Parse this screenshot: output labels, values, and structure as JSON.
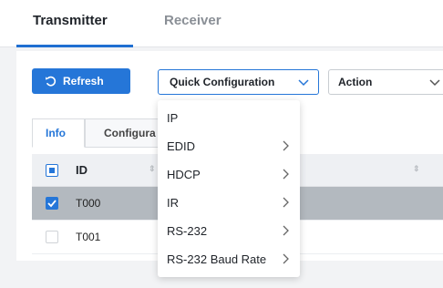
{
  "tabs": {
    "transmitter": "Transmitter",
    "receiver": "Receiver"
  },
  "toolbar": {
    "refresh_label": "Refresh",
    "quick_config_label": "Quick Configuration",
    "action_label": "Action"
  },
  "subtabs": {
    "info": "Info",
    "configuration": "Configura"
  },
  "table": {
    "header_id": "ID",
    "rows": [
      {
        "id": "T000",
        "selected": true
      },
      {
        "id": "T001",
        "selected": false
      }
    ]
  },
  "quick_menu": {
    "items": [
      {
        "label": "IP",
        "submenu": false
      },
      {
        "label": "EDID",
        "submenu": true
      },
      {
        "label": "HDCP",
        "submenu": true
      },
      {
        "label": "IR",
        "submenu": true
      },
      {
        "label": "RS-232",
        "submenu": true
      },
      {
        "label": "RS-232 Baud Rate",
        "submenu": true
      }
    ]
  },
  "colors": {
    "accent": "#2576d8",
    "selected_row": "#b3b9bf"
  }
}
